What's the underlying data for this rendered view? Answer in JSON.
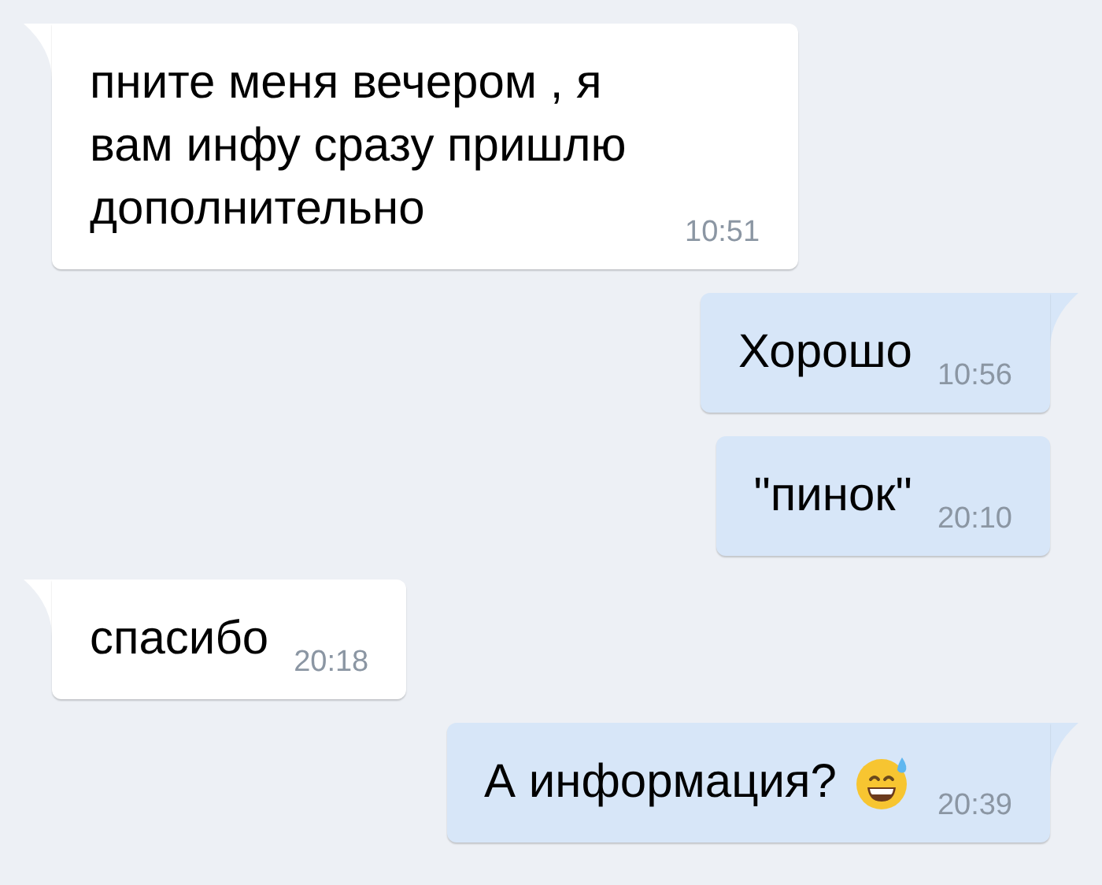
{
  "messages": [
    {
      "kind": "incoming",
      "tail": true,
      "text": "пните меня вечером , я вам инфу сразу пришлю дополнительно",
      "time": "10:51",
      "emoji": false
    },
    {
      "kind": "outgoing",
      "tail": true,
      "text": "Хорошо",
      "time": "10:56",
      "emoji": false
    },
    {
      "kind": "outgoing",
      "tail": false,
      "text": "\"пинок\"",
      "time": "20:10",
      "emoji": false
    },
    {
      "kind": "incoming",
      "tail": true,
      "text": "спасибо",
      "time": "20:18",
      "emoji": false
    },
    {
      "kind": "outgoing",
      "tail": true,
      "text": "А информация?",
      "time": "20:39",
      "emoji": true
    }
  ]
}
